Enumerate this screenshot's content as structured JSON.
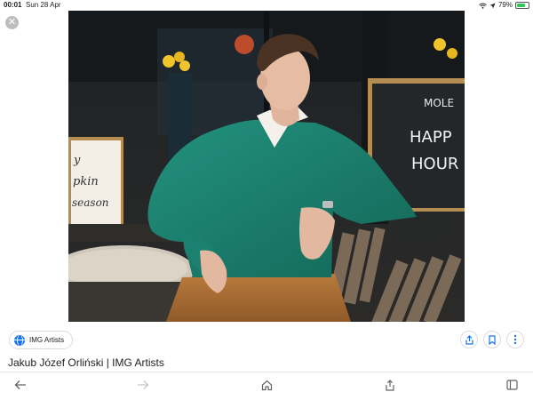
{
  "status_bar": {
    "time": "00:01",
    "date": "Sun 28 Apr",
    "battery": "79%",
    "battery_level": 0.79
  },
  "viewer": {
    "source_name": "IMG Artists",
    "page_title": "Jakub Józef Orliński | IMG Artists"
  },
  "photo_signs": {
    "left_sign": [
      "y",
      "pkin",
      "season"
    ],
    "right_sign": [
      "MOLE",
      "HAPP",
      "HOUR"
    ]
  },
  "icons": {
    "close": "close-icon",
    "share": "share-icon",
    "bookmark": "bookmark-icon",
    "more": "more-icon",
    "back": "back-arrow-icon",
    "forward": "forward-arrow-icon",
    "home": "home-icon",
    "tabs": "tabs-icon"
  },
  "colors": {
    "accent": "#1a73e8",
    "sweater": "#1f8a79"
  }
}
